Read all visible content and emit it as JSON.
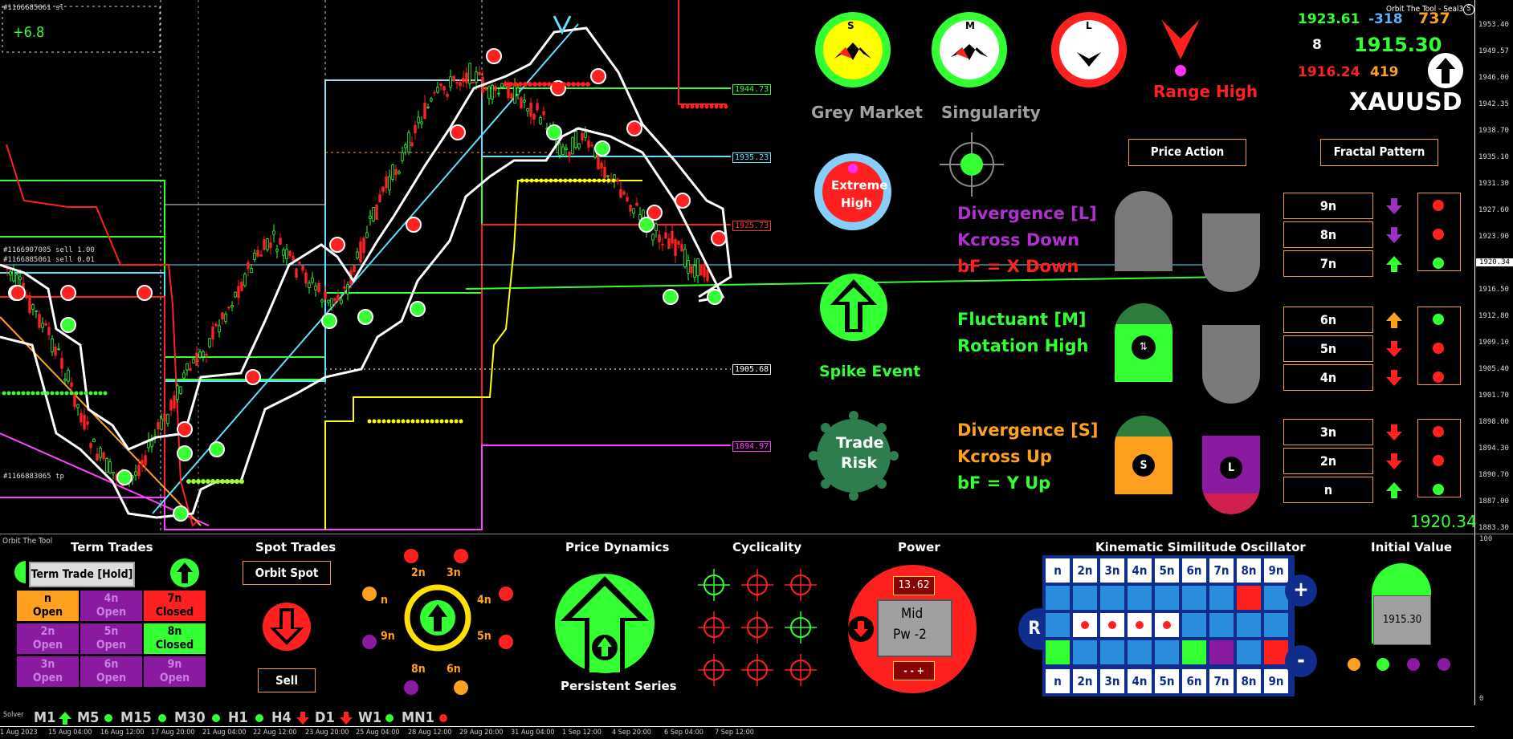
{
  "chart": {
    "symbol_header": "#1166685061 sl",
    "delta": "+6.8",
    "order_line_1": "#1166907005 sell 1.00",
    "order_line_2": "#1166885061 sell 0.01",
    "order_line_3": "#1166883065 tp",
    "price_levels": [
      {
        "label": "1944.73",
        "color": "#33ff33"
      },
      {
        "label": "1935.23",
        "color": "#5fe0ff"
      },
      {
        "label": "1925.73",
        "color": "#ff3030"
      },
      {
        "label": "1905.68",
        "color": "#ffffff"
      },
      {
        "label": "1894.97",
        "color": "#ff40ff"
      }
    ],
    "price_axis": [
      "1953.40",
      "1949.57",
      "1946.00",
      "1942.35",
      "1938.70",
      "1935.10",
      "1931.30",
      "1927.60",
      "1923.90",
      "1920.34",
      "1916.50",
      "1912.80",
      "1909.10",
      "1905.40",
      "1901.70",
      "1898.00",
      "1894.30",
      "1890.70",
      "1887.00",
      "1883.30"
    ],
    "current_price": "1920.34",
    "indicator_name": "Orbit The Tool",
    "solver_name": "Solver",
    "oscillator_axis": [
      "100",
      "0"
    ],
    "time_axis": [
      "1 Aug 2023",
      "15 Aug 04:00",
      "16 Aug 12:00",
      "17 Aug 20:00",
      "21 Aug 04:00",
      "22 Aug 12:00",
      "23 Aug 20:00",
      "25 Aug 04:00",
      "28 Aug 12:00",
      "29 Aug 20:00",
      "31 Aug 04:00",
      "1 Sep 12:00",
      "4 Sep 20:00",
      "6 Sep 04:00",
      "7 Sep 12:00"
    ]
  },
  "dashboard": {
    "title_right": "Orbit The Tool - Seal3",
    "stats": {
      "v1": "1923.61",
      "v2": "-318",
      "v3": "737",
      "v4": "8",
      "v5": "1915.30",
      "v6": "1916.24",
      "v7": "419"
    },
    "symbol": "XAUUSD",
    "gauges": [
      {
        "letter": "S",
        "label": "Grey Market"
      },
      {
        "letter": "M",
        "label": "Singularity"
      },
      {
        "letter": "L",
        "label": ""
      }
    ],
    "range_label": "Range High",
    "extreme_label_1": "Extreme",
    "extreme_label_2": "High",
    "spike_label": "Spike Event",
    "trade_risk_1": "Trade",
    "trade_risk_2": "Risk",
    "price_action": "Price Action",
    "fractal_pattern": "Fractal Pattern",
    "signals": [
      {
        "text": "Divergence [L]",
        "color": "#b030d0"
      },
      {
        "text": "Kcross Down",
        "color": "#b030d0"
      },
      {
        "text": "bF = X Down",
        "color": "#ff2020"
      },
      {
        "text": "Fluctuant [M]",
        "color": "#33ff33"
      },
      {
        "text": "Rotation High",
        "color": "#33ff33"
      },
      {
        "text": "Divergence [S]",
        "color": "#ffa020"
      },
      {
        "text": "Kcross Up",
        "color": "#ffa020"
      },
      {
        "text": "bF = Y Up",
        "color": "#33ff33"
      }
    ],
    "fractals": [
      "9n",
      "8n",
      "7n",
      "6n",
      "5n",
      "4n",
      "3n",
      "2n",
      "n"
    ],
    "marker_s": "S",
    "marker_l": "L"
  },
  "bottom": {
    "term_title": "Term Trades",
    "term_button": "Term Trade [Hold]",
    "orders": [
      {
        "n": "n",
        "s": "Open",
        "bg": "#ffa020"
      },
      {
        "n": "4n",
        "s": "Open",
        "bg": "#8a1aa0"
      },
      {
        "n": "7n",
        "s": "Closed",
        "bg": "#ff2020"
      },
      {
        "n": "2n",
        "s": "Open",
        "bg": "#8a1aa0"
      },
      {
        "n": "5n",
        "s": "Open",
        "bg": "#8a1aa0"
      },
      {
        "n": "8n",
        "s": "Closed",
        "bg": "#33ff33"
      },
      {
        "n": "3n",
        "s": "Open",
        "bg": "#8a1aa0"
      },
      {
        "n": "6n",
        "s": "Open",
        "bg": "#8a1aa0"
      },
      {
        "n": "9n",
        "s": "Open",
        "bg": "#8a1aa0"
      }
    ],
    "spot_title": "Spot Trades",
    "spot_button": "Orbit Spot",
    "sell_button": "Sell",
    "cycle_labels": [
      "2n",
      "3n",
      "n",
      "4n",
      "9n",
      "5n",
      "8n",
      "6n"
    ],
    "price_dyn_title": "Price Dynamics",
    "persistent": "Persistent Series",
    "cyclicality_title": "Cyclicality",
    "power_title": "Power",
    "power_value": "13.62",
    "power_mid_1": "Mid",
    "power_mid_2": "Pw -2",
    "power_pm": "- - +",
    "kso_title": "Kinematic Similitude Oscillator",
    "kso_headers": [
      "n",
      "2n",
      "3n",
      "4n",
      "5n",
      "6n",
      "7n",
      "8n",
      "9n"
    ],
    "kso_r": "R",
    "kso_plus": "+",
    "kso_minus": "-",
    "initial_title": "Initial Value",
    "initial_value": "1915.30",
    "timeframes": [
      {
        "label": "M1",
        "ind": "up"
      },
      {
        "label": "M5",
        "ind": "dot"
      },
      {
        "label": "M15",
        "ind": "dot"
      },
      {
        "label": "M30",
        "ind": "dot"
      },
      {
        "label": "H1",
        "ind": "dot"
      },
      {
        "label": "H4",
        "ind": "down"
      },
      {
        "label": "D1",
        "ind": "down"
      },
      {
        "label": "W1",
        "ind": "dot"
      },
      {
        "label": "MN1",
        "ind": "dotred"
      }
    ]
  }
}
